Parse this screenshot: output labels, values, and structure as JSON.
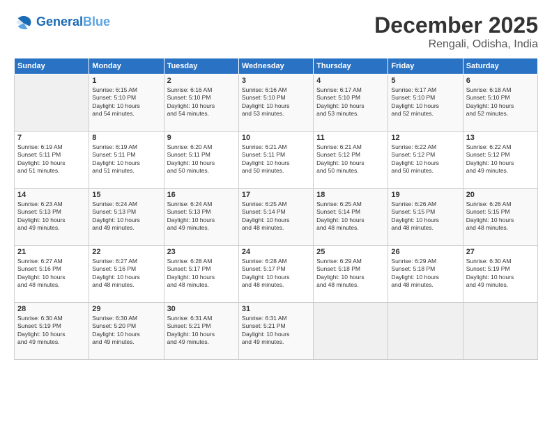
{
  "header": {
    "logo_general": "General",
    "logo_blue": "Blue",
    "month_year": "December 2025",
    "location": "Rengali, Odisha, India"
  },
  "weekdays": [
    "Sunday",
    "Monday",
    "Tuesday",
    "Wednesday",
    "Thursday",
    "Friday",
    "Saturday"
  ],
  "weeks": [
    [
      {
        "day": "",
        "info": ""
      },
      {
        "day": "1",
        "info": "Sunrise: 6:15 AM\nSunset: 5:10 PM\nDaylight: 10 hours\nand 54 minutes."
      },
      {
        "day": "2",
        "info": "Sunrise: 6:16 AM\nSunset: 5:10 PM\nDaylight: 10 hours\nand 54 minutes."
      },
      {
        "day": "3",
        "info": "Sunrise: 6:16 AM\nSunset: 5:10 PM\nDaylight: 10 hours\nand 53 minutes."
      },
      {
        "day": "4",
        "info": "Sunrise: 6:17 AM\nSunset: 5:10 PM\nDaylight: 10 hours\nand 53 minutes."
      },
      {
        "day": "5",
        "info": "Sunrise: 6:17 AM\nSunset: 5:10 PM\nDaylight: 10 hours\nand 52 minutes."
      },
      {
        "day": "6",
        "info": "Sunrise: 6:18 AM\nSunset: 5:10 PM\nDaylight: 10 hours\nand 52 minutes."
      }
    ],
    [
      {
        "day": "7",
        "info": "Sunrise: 6:19 AM\nSunset: 5:11 PM\nDaylight: 10 hours\nand 51 minutes."
      },
      {
        "day": "8",
        "info": "Sunrise: 6:19 AM\nSunset: 5:11 PM\nDaylight: 10 hours\nand 51 minutes."
      },
      {
        "day": "9",
        "info": "Sunrise: 6:20 AM\nSunset: 5:11 PM\nDaylight: 10 hours\nand 50 minutes."
      },
      {
        "day": "10",
        "info": "Sunrise: 6:21 AM\nSunset: 5:11 PM\nDaylight: 10 hours\nand 50 minutes."
      },
      {
        "day": "11",
        "info": "Sunrise: 6:21 AM\nSunset: 5:12 PM\nDaylight: 10 hours\nand 50 minutes."
      },
      {
        "day": "12",
        "info": "Sunrise: 6:22 AM\nSunset: 5:12 PM\nDaylight: 10 hours\nand 50 minutes."
      },
      {
        "day": "13",
        "info": "Sunrise: 6:22 AM\nSunset: 5:12 PM\nDaylight: 10 hours\nand 49 minutes."
      }
    ],
    [
      {
        "day": "14",
        "info": "Sunrise: 6:23 AM\nSunset: 5:13 PM\nDaylight: 10 hours\nand 49 minutes."
      },
      {
        "day": "15",
        "info": "Sunrise: 6:24 AM\nSunset: 5:13 PM\nDaylight: 10 hours\nand 49 minutes."
      },
      {
        "day": "16",
        "info": "Sunrise: 6:24 AM\nSunset: 5:13 PM\nDaylight: 10 hours\nand 49 minutes."
      },
      {
        "day": "17",
        "info": "Sunrise: 6:25 AM\nSunset: 5:14 PM\nDaylight: 10 hours\nand 48 minutes."
      },
      {
        "day": "18",
        "info": "Sunrise: 6:25 AM\nSunset: 5:14 PM\nDaylight: 10 hours\nand 48 minutes."
      },
      {
        "day": "19",
        "info": "Sunrise: 6:26 AM\nSunset: 5:15 PM\nDaylight: 10 hours\nand 48 minutes."
      },
      {
        "day": "20",
        "info": "Sunrise: 6:26 AM\nSunset: 5:15 PM\nDaylight: 10 hours\nand 48 minutes."
      }
    ],
    [
      {
        "day": "21",
        "info": "Sunrise: 6:27 AM\nSunset: 5:16 PM\nDaylight: 10 hours\nand 48 minutes."
      },
      {
        "day": "22",
        "info": "Sunrise: 6:27 AM\nSunset: 5:16 PM\nDaylight: 10 hours\nand 48 minutes."
      },
      {
        "day": "23",
        "info": "Sunrise: 6:28 AM\nSunset: 5:17 PM\nDaylight: 10 hours\nand 48 minutes."
      },
      {
        "day": "24",
        "info": "Sunrise: 6:28 AM\nSunset: 5:17 PM\nDaylight: 10 hours\nand 48 minutes."
      },
      {
        "day": "25",
        "info": "Sunrise: 6:29 AM\nSunset: 5:18 PM\nDaylight: 10 hours\nand 48 minutes."
      },
      {
        "day": "26",
        "info": "Sunrise: 6:29 AM\nSunset: 5:18 PM\nDaylight: 10 hours\nand 48 minutes."
      },
      {
        "day": "27",
        "info": "Sunrise: 6:30 AM\nSunset: 5:19 PM\nDaylight: 10 hours\nand 49 minutes."
      }
    ],
    [
      {
        "day": "28",
        "info": "Sunrise: 6:30 AM\nSunset: 5:19 PM\nDaylight: 10 hours\nand 49 minutes."
      },
      {
        "day": "29",
        "info": "Sunrise: 6:30 AM\nSunset: 5:20 PM\nDaylight: 10 hours\nand 49 minutes."
      },
      {
        "day": "30",
        "info": "Sunrise: 6:31 AM\nSunset: 5:21 PM\nDaylight: 10 hours\nand 49 minutes."
      },
      {
        "day": "31",
        "info": "Sunrise: 6:31 AM\nSunset: 5:21 PM\nDaylight: 10 hours\nand 49 minutes."
      },
      {
        "day": "",
        "info": ""
      },
      {
        "day": "",
        "info": ""
      },
      {
        "day": "",
        "info": ""
      }
    ]
  ]
}
